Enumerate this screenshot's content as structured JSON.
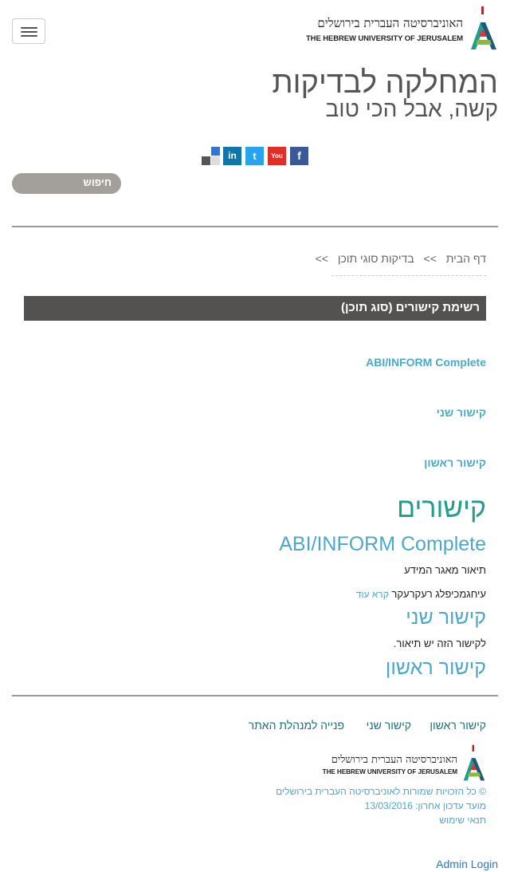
{
  "header": {
    "logo_hebrew": "האוניברסיטה העברית בירושלים",
    "logo_english": "THE HEBREW UNIVERSITY OF JERUSALEM",
    "site_title": "המחלקה לבדיקות",
    "site_slogan": "קשה, אבל הכי טוב",
    "search_label": "חיפוש"
  },
  "social": {
    "facebook": "f",
    "youtube": "You",
    "twitter": "t",
    "linkedin": "in"
  },
  "breadcrumb": {
    "home": "דף הבית",
    "sep1": ">>",
    "section": "בדיקות סוגי תוכן",
    "sep2": ">>"
  },
  "block": {
    "title": "רשימת קישורים (סוג תוכן)",
    "links": [
      "ABI/INFORM Complete",
      "קישור שני",
      "קישור ראשון"
    ]
  },
  "links_section": {
    "heading": "קישורים",
    "items": [
      {
        "title": "ABI/INFORM Complete",
        "desc": "תיאור מאגר המידע"
      },
      {
        "title": "קישור שני",
        "desc": "לקישור הזה יש תיאור."
      },
      {
        "title": "קישור ראשון"
      }
    ],
    "extra_desc": "עיחגמכיפלג רעקרעקר",
    "read_more": "קרא עוד"
  },
  "footer": {
    "links": [
      "קישור ראשון",
      "קישור שני",
      "פנייה למנהלת האתר"
    ],
    "copyright": "© כל הזכויות שמורות לאוניברסיטה העברית בירושלים",
    "updated": "מועד עדכון אחרון: 13/03/2016",
    "terms": "תנאי שימוש",
    "admin_login": "Admin Login"
  },
  "colors": {
    "teal_link": "#4ba8c8",
    "heading_green": "#1f9e8c",
    "block_header_bg": "#545250",
    "search_bg": "#a39f9a"
  }
}
